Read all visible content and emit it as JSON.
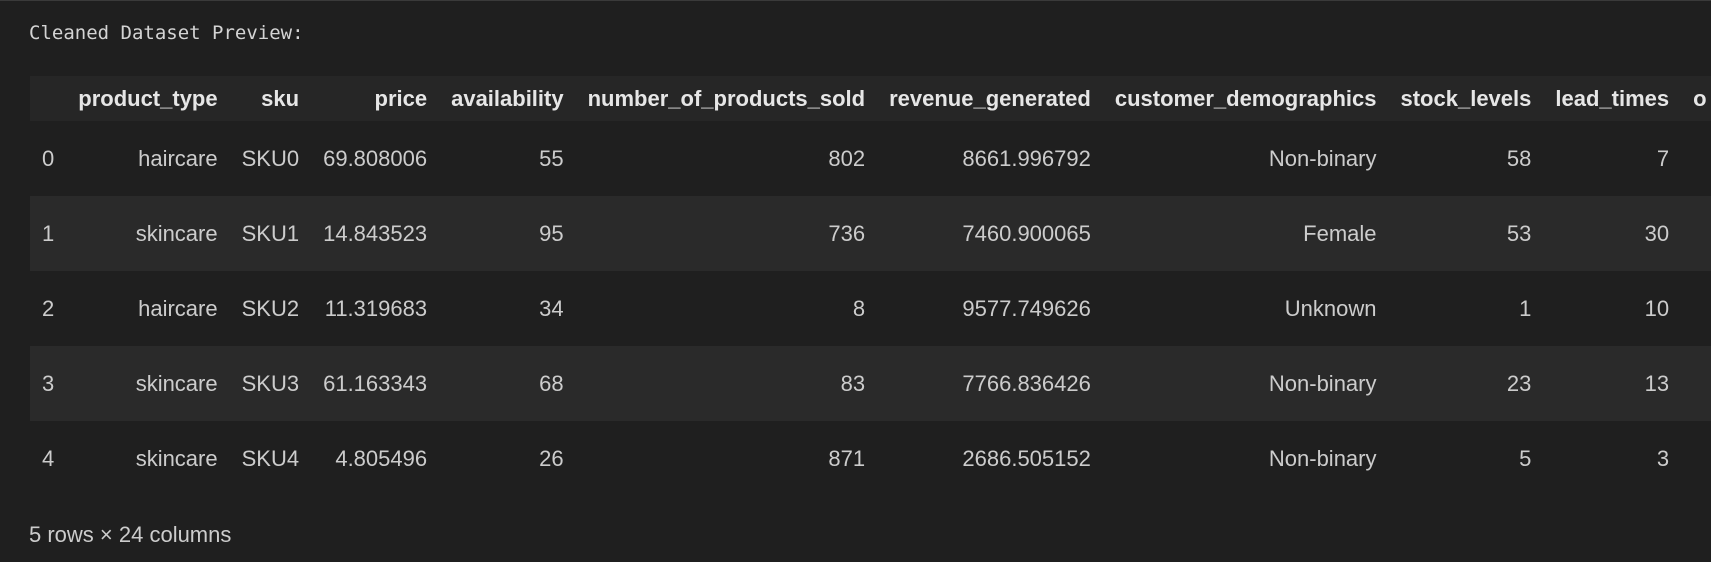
{
  "output": {
    "stdout_line": "Cleaned Dataset Preview:"
  },
  "table": {
    "columns": [
      "",
      "product_type",
      "sku",
      "price",
      "availability",
      "number_of_products_sold",
      "revenue_generated",
      "customer_demographics",
      "stock_levels",
      "lead_times",
      "o"
    ],
    "rows": [
      [
        "0",
        "haircare",
        "SKU0",
        "69.808006",
        "55",
        "802",
        "8661.996792",
        "Non-binary",
        "58",
        "7",
        ""
      ],
      [
        "1",
        "skincare",
        "SKU1",
        "14.843523",
        "95",
        "736",
        "7460.900065",
        "Female",
        "53",
        "30",
        ""
      ],
      [
        "2",
        "haircare",
        "SKU2",
        "11.319683",
        "34",
        "8",
        "9577.749626",
        "Unknown",
        "1",
        "10",
        ""
      ],
      [
        "3",
        "skincare",
        "SKU3",
        "61.163343",
        "68",
        "83",
        "7766.836426",
        "Non-binary",
        "23",
        "13",
        ""
      ],
      [
        "4",
        "skincare",
        "SKU4",
        "4.805496",
        "26",
        "871",
        "2686.505152",
        "Non-binary",
        "5",
        "3",
        ""
      ]
    ],
    "summary": "5 rows × 24 columns"
  }
}
